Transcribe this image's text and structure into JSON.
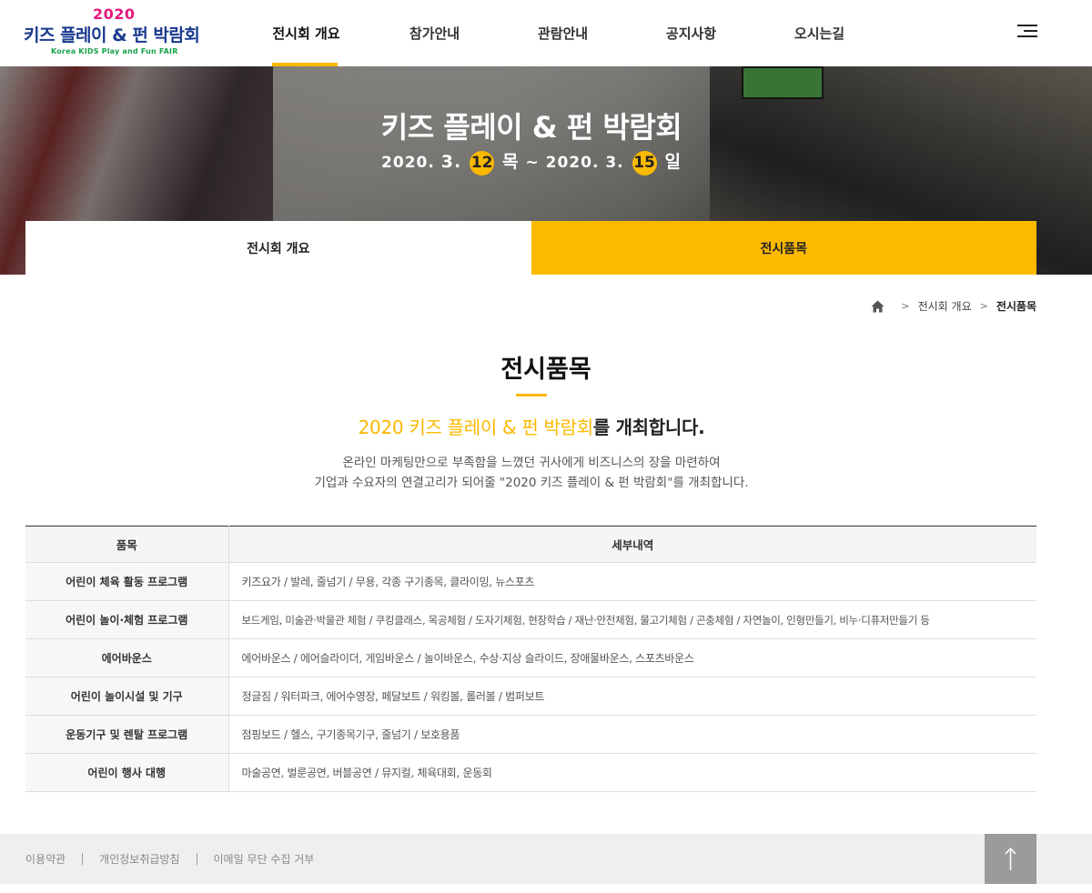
{
  "logo": {
    "year": "2020",
    "main": "키즈 플레이 & 펀 박람회",
    "sub": "Korea KIDS Play and Fun FAIR"
  },
  "nav": {
    "items": [
      {
        "label": "전시회 개요",
        "active": true
      },
      {
        "label": "참가안내",
        "active": false
      },
      {
        "label": "관람안내",
        "active": false
      },
      {
        "label": "공지사항",
        "active": false
      },
      {
        "label": "오시는길",
        "active": false
      }
    ],
    "menu_icon": "hamburger-icon"
  },
  "hero": {
    "title": "키즈 플레이 & 펀 박람회",
    "date": {
      "start_prefix": "2020.",
      "start_month": "3.",
      "start_day": "12",
      "start_weekday": "목",
      "separator": "~",
      "end_prefix": "2020. 3.",
      "end_day": "15",
      "end_weekday": "일"
    }
  },
  "subtabs": [
    {
      "label": "전시회 개요",
      "active": false
    },
    {
      "label": "전시품목",
      "active": true
    }
  ],
  "breadcrumb": {
    "home_icon": "home-icon",
    "items": [
      "전시회 개요",
      "전시품목"
    ]
  },
  "content": {
    "title": "전시품목",
    "headline_highlight": "2020 키즈 플레이 & 펀 박람회",
    "headline_rest": "를 개최합니다.",
    "desc_line1": "온라인 마케팅만으로 부족함을 느꼈던 귀사에게 비즈니스의 장을 마련하여",
    "desc_line2": "기업과 수요자의 연결고리가 되어줄 \"2020 키즈 플레이 & 펀 박람회\"를 개최합니다."
  },
  "table": {
    "headers": [
      "품목",
      "세부내역"
    ],
    "rows": [
      {
        "item": "어린이 체육 활동 프로그램",
        "detail": "키즈요가 / 발레, 줄넘기 / 무용, 각종 구기종목, 클라이밍, 뉴스포츠"
      },
      {
        "item": "어린이 놀이·체험 프로그램",
        "detail": "보드게임, 미술관·박물관 체험 / 쿠킹클래스, 목공체험 / 도자기체험, 현장학습 / 재난·안전체험, 물고기체험 / 곤충체험 / 자연놀이, 인형만들기, 비누·디퓨저만들기 등"
      },
      {
        "item": "에어바운스",
        "detail": "에어바운스 / 에어슬라이더, 게임바운스 / 놀이바운스, 수상·지상 슬라이드, 장애물바운스, 스포츠바운스"
      },
      {
        "item": "어린이 놀이시설 및 기구",
        "detail": "정글짐 / 워터파크, 에어수영장, 페달보트 / 워킹볼, 롤러볼 / 범퍼보트"
      },
      {
        "item": "운동기구 및 렌탈 프로그램",
        "detail": "점핑보드 / 헬스, 구기종목기구, 줄넘기 / 보호용품"
      },
      {
        "item": "어린이 행사 대행",
        "detail": "마술공연, 벌룬공연, 버블공연 / 뮤지컬, 체육대회, 운동회"
      }
    ]
  },
  "footer": {
    "links": [
      "이용약관",
      "개인정보취급방침",
      "이메일 무단 수집 거부"
    ],
    "top_icon": "arrow-up-icon"
  },
  "colors": {
    "accent": "#fbb900",
    "logo_blue": "#1a3a8f",
    "logo_pink": "#e5197c",
    "logo_green": "#17a34a",
    "footer_bg": "#efefef"
  }
}
